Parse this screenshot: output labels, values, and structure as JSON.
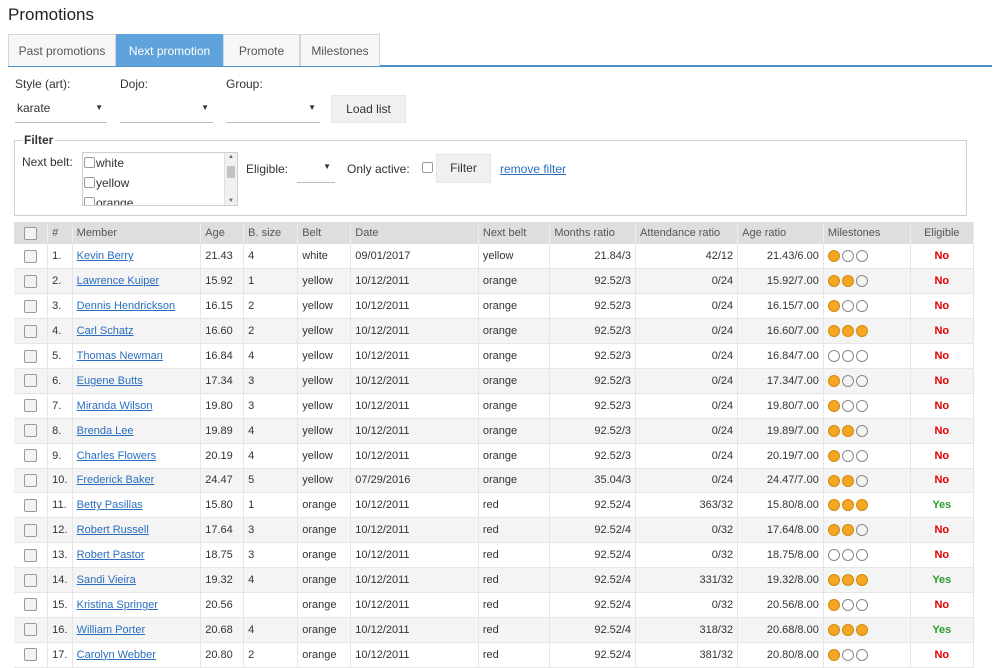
{
  "page_title": "Promotions",
  "tabs": [
    {
      "label": "Past promotions",
      "active": false
    },
    {
      "label": "Next promotion",
      "active": true
    },
    {
      "label": "Promote",
      "active": false
    },
    {
      "label": "Milestones",
      "active": false
    }
  ],
  "selectors": {
    "style_label": "Style (art):",
    "style_value": "karate",
    "dojo_label": "Dojo:",
    "dojo_value": "",
    "group_label": "Group:",
    "group_value": "",
    "load_button": "Load list"
  },
  "filter": {
    "legend": "Filter",
    "next_belt_label": "Next belt:",
    "next_belt_options": [
      "white",
      "yellow",
      "orange"
    ],
    "eligible_label": "Eligible:",
    "eligible_value": "",
    "only_active_label": "Only active:",
    "filter_button": "Filter",
    "remove_filter": "remove filter"
  },
  "colors": {
    "accent": "#5ea3db",
    "link": "#2a6ebf",
    "milestone_on": "#f5a623",
    "eligible_no": "#e00000",
    "eligible_yes": "#2e9b2e"
  },
  "table": {
    "columns": [
      "",
      "#",
      "Member",
      "Age",
      "B. size",
      "Belt",
      "Date",
      "Next belt",
      "Months ratio",
      "Attendance ratio",
      "Age ratio",
      "Milestones",
      "Eligible"
    ],
    "rows": [
      {
        "n": "1.",
        "member": "Kevin Berry",
        "age": "21.43",
        "bsize": "4",
        "belt": "white",
        "date": "09/01/2017",
        "next": "yellow",
        "months": "21.84/3",
        "att": "42/12",
        "ageratio": "21.43/6.00",
        "milestones": [
          1,
          0,
          0
        ],
        "eligible": "No"
      },
      {
        "n": "2.",
        "member": "Lawrence Kuiper",
        "age": "15.92",
        "bsize": "1",
        "belt": "yellow",
        "date": "10/12/2011",
        "next": "orange",
        "months": "92.52/3",
        "att": "0/24",
        "ageratio": "15.92/7.00",
        "milestones": [
          1,
          1,
          0
        ],
        "eligible": "No"
      },
      {
        "n": "3.",
        "member": "Dennis Hendrickson",
        "age": "16.15",
        "bsize": "2",
        "belt": "yellow",
        "date": "10/12/2011",
        "next": "orange",
        "months": "92.52/3",
        "att": "0/24",
        "ageratio": "16.15/7.00",
        "milestones": [
          1,
          0,
          0
        ],
        "eligible": "No"
      },
      {
        "n": "4.",
        "member": "Carl Schatz",
        "age": "16.60",
        "bsize": "2",
        "belt": "yellow",
        "date": "10/12/2011",
        "next": "orange",
        "months": "92.52/3",
        "att": "0/24",
        "ageratio": "16.60/7.00",
        "milestones": [
          1,
          1,
          1
        ],
        "eligible": "No"
      },
      {
        "n": "5.",
        "member": "Thomas Newman",
        "age": "16.84",
        "bsize": "4",
        "belt": "yellow",
        "date": "10/12/2011",
        "next": "orange",
        "months": "92.52/3",
        "att": "0/24",
        "ageratio": "16.84/7.00",
        "milestones": [
          0,
          0,
          0
        ],
        "eligible": "No"
      },
      {
        "n": "6.",
        "member": "Eugene Butts",
        "age": "17.34",
        "bsize": "3",
        "belt": "yellow",
        "date": "10/12/2011",
        "next": "orange",
        "months": "92.52/3",
        "att": "0/24",
        "ageratio": "17.34/7.00",
        "milestones": [
          1,
          0,
          0
        ],
        "eligible": "No"
      },
      {
        "n": "7.",
        "member": "Miranda Wilson",
        "age": "19.80",
        "bsize": "3",
        "belt": "yellow",
        "date": "10/12/2011",
        "next": "orange",
        "months": "92.52/3",
        "att": "0/24",
        "ageratio": "19.80/7.00",
        "milestones": [
          1,
          0,
          0
        ],
        "eligible": "No"
      },
      {
        "n": "8.",
        "member": "Brenda Lee",
        "age": "19.89",
        "bsize": "4",
        "belt": "yellow",
        "date": "10/12/2011",
        "next": "orange",
        "months": "92.52/3",
        "att": "0/24",
        "ageratio": "19.89/7.00",
        "milestones": [
          1,
          1,
          0
        ],
        "eligible": "No"
      },
      {
        "n": "9.",
        "member": "Charles Flowers",
        "age": "20.19",
        "bsize": "4",
        "belt": "yellow",
        "date": "10/12/2011",
        "next": "orange",
        "months": "92.52/3",
        "att": "0/24",
        "ageratio": "20.19/7.00",
        "milestones": [
          1,
          0,
          0
        ],
        "eligible": "No"
      },
      {
        "n": "10.",
        "member": "Frederick Baker",
        "age": "24.47",
        "bsize": "5",
        "belt": "yellow",
        "date": "07/29/2016",
        "next": "orange",
        "months": "35.04/3",
        "att": "0/24",
        "ageratio": "24.47/7.00",
        "milestones": [
          1,
          1,
          0
        ],
        "eligible": "No"
      },
      {
        "n": "11.",
        "member": "Betty Pasillas",
        "age": "15.80",
        "bsize": "1",
        "belt": "orange",
        "date": "10/12/2011",
        "next": "red",
        "months": "92.52/4",
        "att": "363/32",
        "ageratio": "15.80/8.00",
        "milestones": [
          1,
          1,
          1
        ],
        "eligible": "Yes"
      },
      {
        "n": "12.",
        "member": "Robert Russell",
        "age": "17.64",
        "bsize": "3",
        "belt": "orange",
        "date": "10/12/2011",
        "next": "red",
        "months": "92.52/4",
        "att": "0/32",
        "ageratio": "17.64/8.00",
        "milestones": [
          1,
          1,
          0
        ],
        "eligible": "No"
      },
      {
        "n": "13.",
        "member": "Robert Pastor",
        "age": "18.75",
        "bsize": "3",
        "belt": "orange",
        "date": "10/12/2011",
        "next": "red",
        "months": "92.52/4",
        "att": "0/32",
        "ageratio": "18.75/8.00",
        "milestones": [
          0,
          0,
          0
        ],
        "eligible": "No"
      },
      {
        "n": "14.",
        "member": "Sandi Vieira",
        "age": "19.32",
        "bsize": "4",
        "belt": "orange",
        "date": "10/12/2011",
        "next": "red",
        "months": "92.52/4",
        "att": "331/32",
        "ageratio": "19.32/8.00",
        "milestones": [
          1,
          1,
          1
        ],
        "eligible": "Yes"
      },
      {
        "n": "15.",
        "member": "Kristina Springer",
        "age": "20.56",
        "bsize": "",
        "belt": "orange",
        "date": "10/12/2011",
        "next": "red",
        "months": "92.52/4",
        "att": "0/32",
        "ageratio": "20.56/8.00",
        "milestones": [
          1,
          0,
          0
        ],
        "eligible": "No"
      },
      {
        "n": "16.",
        "member": "William Porter",
        "age": "20.68",
        "bsize": "4",
        "belt": "orange",
        "date": "10/12/2011",
        "next": "red",
        "months": "92.52/4",
        "att": "318/32",
        "ageratio": "20.68/8.00",
        "milestones": [
          1,
          1,
          1
        ],
        "eligible": "Yes"
      },
      {
        "n": "17.",
        "member": "Carolyn Webber",
        "age": "20.80",
        "bsize": "2",
        "belt": "orange",
        "date": "10/12/2011",
        "next": "red",
        "months": "92.52/4",
        "att": "381/32",
        "ageratio": "20.80/8.00",
        "milestones": [
          1,
          0,
          0
        ],
        "eligible": "No"
      }
    ]
  }
}
